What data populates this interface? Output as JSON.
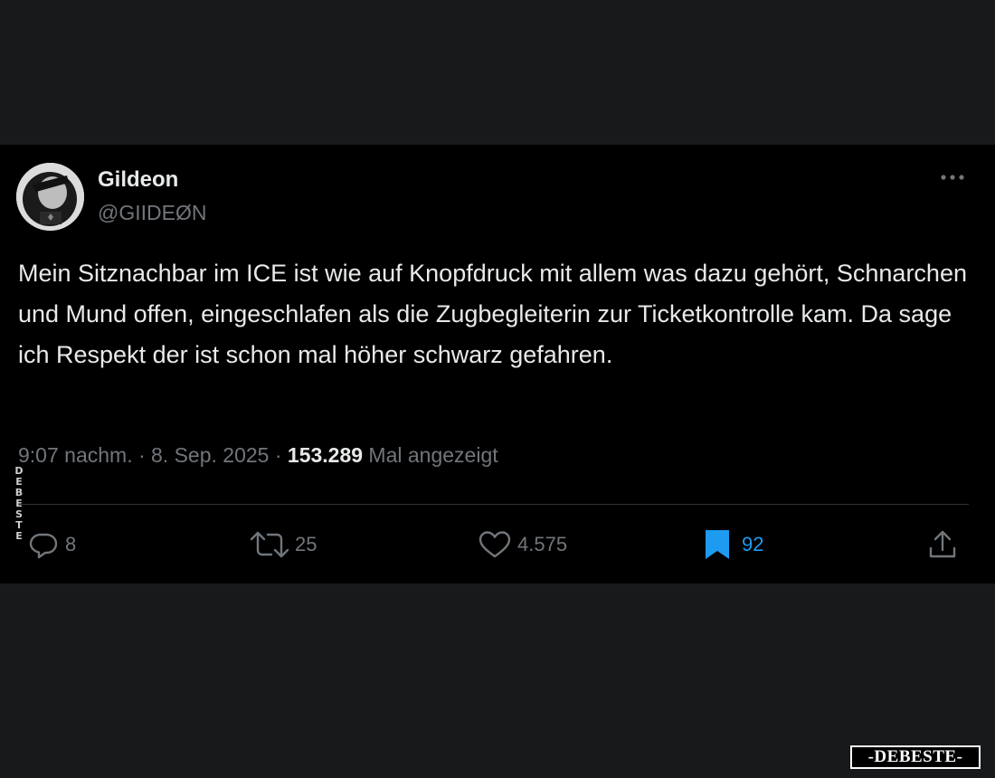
{
  "tweet": {
    "author_name": "Gildeon",
    "author_handle": "@GIIDEØN",
    "text": "Mein Sitznachbar im ICE ist wie auf Knopfdruck mit allem was dazu gehört, Schnarchen und Mund offen, eingeschlafen als die Zugbegleiterin zur Ticketkontrolle kam. Da sage ich Respekt der ist schon mal höher schwarz gefahren.",
    "timestamp": "9:07 nachm. · 8. Sep. 2025 · ",
    "views_count": "153.289",
    "views_label": " Mal angezeigt",
    "actions": {
      "replies": "8",
      "retweets": "25",
      "likes": "4.575",
      "bookmarks": "92"
    }
  },
  "colors": {
    "page_background": "#18191a",
    "card_background": "#000000",
    "primary_text": "#e7e9ea",
    "secondary_text": "#71767b",
    "bookmark_accent": "#1d9bf0"
  },
  "icons": [
    "more-icon",
    "reply-icon",
    "retweet-icon",
    "like-icon",
    "bookmark-icon",
    "share-icon"
  ],
  "watermarks": {
    "side_text": "DEBESTE",
    "logo_text": "-DEBESTE-"
  }
}
